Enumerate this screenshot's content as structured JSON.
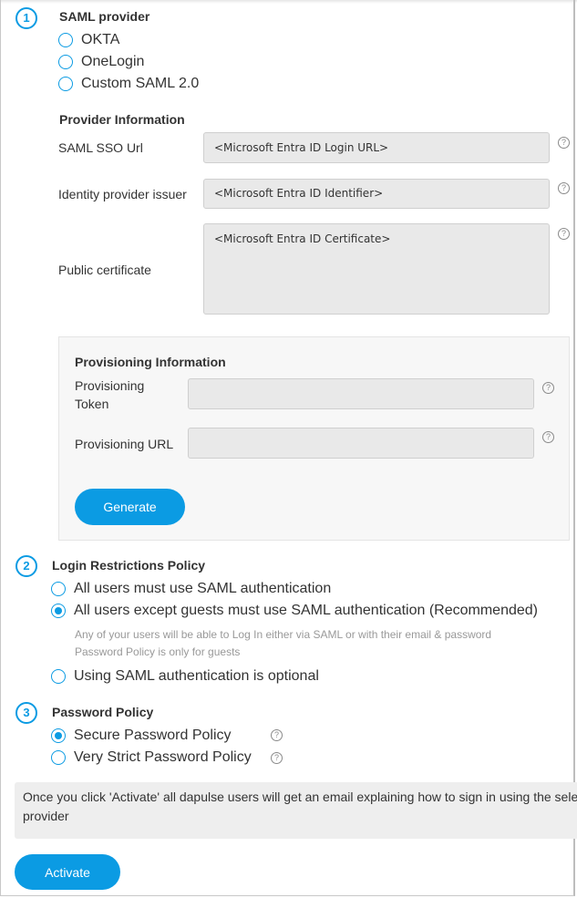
{
  "saml_provider": {
    "step": "1",
    "title": "SAML provider",
    "options": [
      {
        "label": "OKTA",
        "checked": false
      },
      {
        "label": "OneLogin",
        "checked": false
      },
      {
        "label": "Custom SAML 2.0",
        "checked": false
      }
    ]
  },
  "provider_info": {
    "title": "Provider Information",
    "fields": [
      {
        "label": "SAML SSO Url",
        "value": "<Microsoft Entra ID Login URL>"
      },
      {
        "label": "Identity provider issuer",
        "value": "<Microsoft Entra ID Identifier>"
      },
      {
        "label": "Public certificate",
        "value": "<Microsoft Entra ID Certificate>"
      }
    ],
    "help_glyph": "?"
  },
  "provisioning": {
    "title": "Provisioning Information",
    "token_label_line1": "Provisioning",
    "token_label_line2": "Token",
    "token_value": "",
    "url_label": "Provisioning URL",
    "url_value": "",
    "generate_label": "Generate"
  },
  "login_policy": {
    "step": "2",
    "title": "Login Restrictions Policy",
    "options": [
      {
        "label": "All users must use SAML authentication",
        "checked": false
      },
      {
        "label": "All users except guests must use SAML authentication (Recommended)",
        "checked": true
      },
      {
        "label": "Using SAML authentication is optional",
        "checked": false
      }
    ],
    "hint_line1": "Any of your users will be able to Log In either via SAML or with their email & password",
    "hint_line2": "Password Policy is only for guests"
  },
  "password_policy": {
    "step": "3",
    "title": "Password Policy",
    "options": [
      {
        "label": "Secure Password Policy",
        "checked": true
      },
      {
        "label": "Very Strict Password Policy",
        "checked": false
      }
    ]
  },
  "notice": {
    "line1": "Once you click 'Activate' all dapulse users will get an email explaining how to sign in using the selected",
    "line2": "provider"
  },
  "activate_label": "Activate",
  "colors": {
    "accent": "#0b9be3",
    "field_bg": "#e9e9e9",
    "panel_bg": "#f7f7f7",
    "notice_bg": "#eeeeee"
  }
}
